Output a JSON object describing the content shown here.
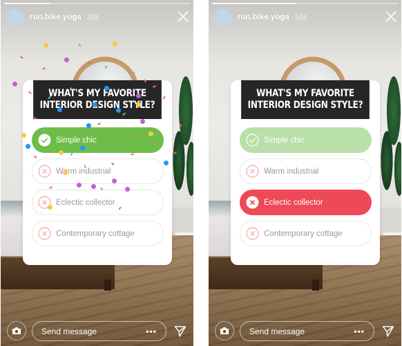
{
  "stories": [
    {
      "username": "run.bike.yoga",
      "timestamp": "26s",
      "progress": 0.25,
      "poll": {
        "question": "What's my favorite interior design style?",
        "options": [
          {
            "label": "Simple chic",
            "state": "correct-chosen",
            "icon": "check-icon"
          },
          {
            "label": "Warm industrial",
            "state": "wrong",
            "icon": "x-circle-icon"
          },
          {
            "label": "Eclectic collector",
            "state": "wrong",
            "icon": "x-circle-icon"
          },
          {
            "label": "Contemporary cottage",
            "state": "wrong",
            "icon": "x-circle-icon"
          }
        ]
      },
      "confetti": true,
      "bottom": {
        "message_placeholder": "Send message",
        "more_label": "•••"
      }
    },
    {
      "username": "run.bike.yoga",
      "timestamp": "51s",
      "progress": 0.45,
      "poll": {
        "question": "What's my favorite interior design style?",
        "options": [
          {
            "label": "Simple chic",
            "state": "correct-revealed",
            "icon": "check-icon"
          },
          {
            "label": "Warm industrial",
            "state": "wrong",
            "icon": "x-circle-icon"
          },
          {
            "label": "Eclectic collector",
            "state": "wrong-chosen",
            "icon": "x-circle-icon"
          },
          {
            "label": "Contemporary cottage",
            "state": "wrong",
            "icon": "x-circle-icon"
          }
        ]
      },
      "confetti": false,
      "bottom": {
        "message_placeholder": "Send message",
        "more_label": "•••"
      }
    }
  ],
  "colors": {
    "correct": "#6ebd4a",
    "correct_revealed": "#b8e0a8",
    "wrong_chosen": "#ed4956",
    "wrong_icon": "#f4a4a8",
    "question_bg": "#262626",
    "avatar": "#c4d6ea",
    "confetti": [
      "#c45fd6",
      "#2196f3",
      "#f7c948",
      "#ef6a6a",
      "#4fd1a5"
    ]
  }
}
